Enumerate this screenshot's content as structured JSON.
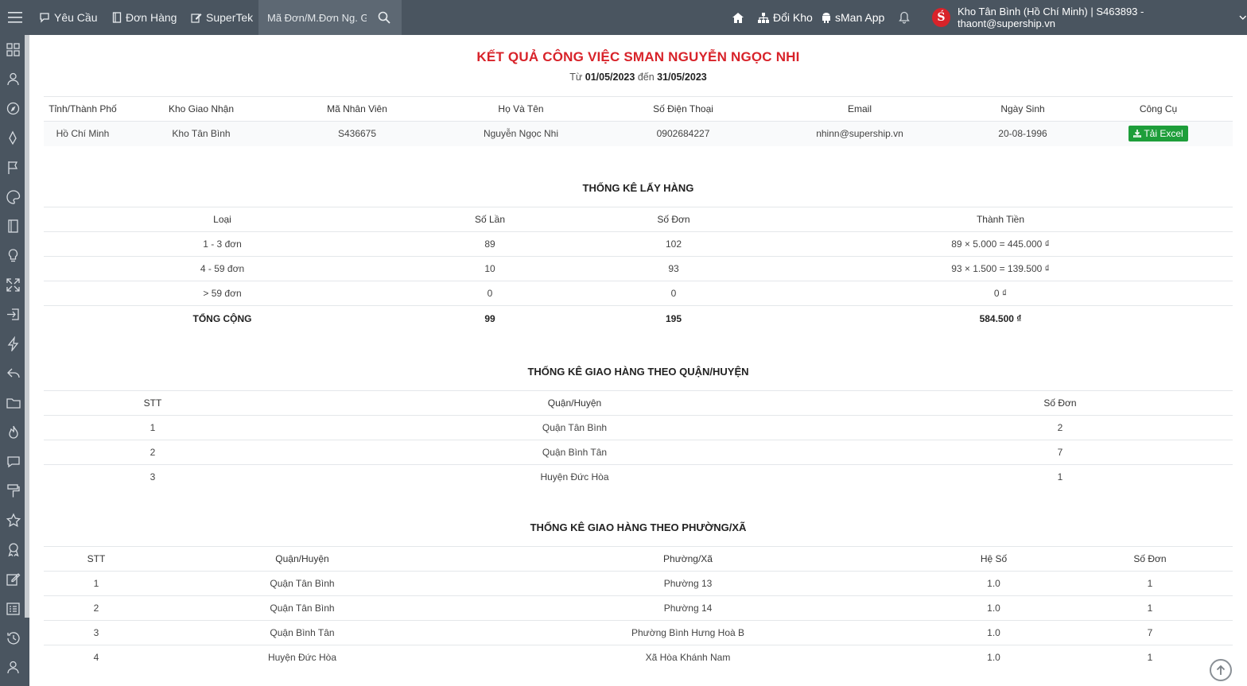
{
  "topbar": {
    "nav": [
      {
        "label": "Yêu Cầu",
        "icon": "chat-icon"
      },
      {
        "label": "Đơn Hàng",
        "icon": "book-icon"
      },
      {
        "label": "SuperTek",
        "icon": "edit-icon"
      }
    ],
    "search_placeholder": "Mã Đơn/M.Đơn Ng. Gửi",
    "switch_warehouse": "Đổi Kho",
    "app_label": "sMan App",
    "account": "Kho Tân Bình (Hồ Chí Minh) | S463893 - thaont@supership.vn",
    "logo_letter": "Ś"
  },
  "sidebar": {
    "icons": [
      "dashboard-icon",
      "user-icon",
      "compass-icon",
      "pen-tool-icon",
      "flag-icon",
      "palette-icon",
      "book-icon",
      "lightbulb-icon",
      "expand-icon",
      "login-icon",
      "bolt-icon",
      "reply-icon",
      "folder-icon",
      "fire-icon",
      "chat-icon",
      "paint-roller-icon",
      "star-icon",
      "award-icon",
      "edit-icon",
      "list-icon",
      "history-icon",
      "user-icon"
    ]
  },
  "report": {
    "title": "KẾT QUẢ CÔNG VIỆC SMAN NGUYỄN NGỌC NHI",
    "range_from_label": "Từ",
    "range_from": "01/05/2023",
    "range_to_label": "đến",
    "range_to": "31/05/2023"
  },
  "info": {
    "headers": [
      "Tỉnh/Thành Phố",
      "Kho Giao Nhận",
      "Mã Nhân Viên",
      "Họ Và Tên",
      "Số Điện Thoại",
      "Email",
      "Ngày Sinh",
      "Công Cụ"
    ],
    "row": [
      "Hồ Chí Minh",
      "Kho Tân Bình",
      "S436675",
      "Nguyễn Ngọc Nhi",
      "0902684227",
      "nhinn@supership.vn",
      "20-08-1996"
    ],
    "excel_button": "Tải Excel"
  },
  "pickup": {
    "title": "THỐNG KÊ LẤY HÀNG",
    "headers": [
      "Loại",
      "Số Lần",
      "Số Đơn",
      "Thành Tiền"
    ],
    "rows": [
      [
        "1 - 3 đơn",
        "89",
        "102",
        "89 × 5.000 = 445.000 ₫"
      ],
      [
        "4 - 59 đơn",
        "10",
        "93",
        "93 × 1.500 = 139.500 ₫"
      ],
      [
        "> 59 đơn",
        "0",
        "0",
        "0 ₫"
      ]
    ],
    "total": [
      "TỔNG CỘNG",
      "99",
      "195",
      "584.500 ₫"
    ]
  },
  "by_district": {
    "title": "THỐNG KÊ GIAO HÀNG THEO QUẬN/HUYỆN",
    "headers": [
      "STT",
      "Quận/Huyện",
      "Số Đơn"
    ],
    "rows": [
      [
        "1",
        "Quận Tân Bình",
        "2"
      ],
      [
        "2",
        "Quận Bình Tân",
        "7"
      ],
      [
        "3",
        "Huyện Đức Hòa",
        "1"
      ]
    ]
  },
  "by_ward": {
    "title": "THỐNG KÊ GIAO HÀNG THEO PHƯỜNG/XÃ",
    "headers": [
      "STT",
      "Quận/Huyện",
      "Phường/Xã",
      "Hệ Số",
      "Số Đơn"
    ],
    "rows": [
      [
        "1",
        "Quận Tân Bình",
        "Phường 13",
        "1.0",
        "1"
      ],
      [
        "2",
        "Quận Tân Bình",
        "Phường 14",
        "1.0",
        "1"
      ],
      [
        "3",
        "Quận Bình Tân",
        "Phường Bình Hưng Hoà B",
        "1.0",
        "7"
      ],
      [
        "4",
        "Huyện Đức Hòa",
        "Xã Hòa Khánh Nam",
        "1.0",
        "1"
      ]
    ]
  }
}
